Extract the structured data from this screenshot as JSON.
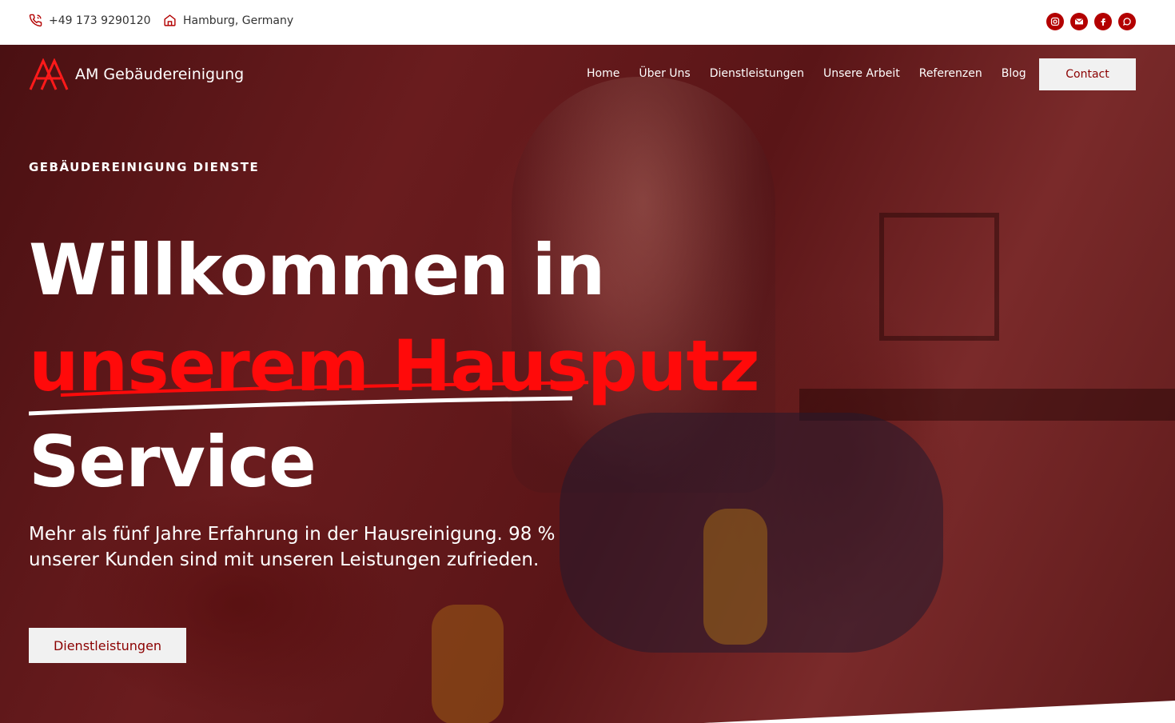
{
  "topbar": {
    "phone": "+49 173 9290120",
    "location": "Hamburg, Germany",
    "socials": [
      "instagram-icon",
      "email-icon",
      "facebook-icon",
      "whatsapp-icon"
    ]
  },
  "brand": {
    "name": "AM Gebäudereinigung",
    "accent": "#ff0a0a",
    "dark_red": "#8b0000"
  },
  "nav": {
    "items": [
      "Home",
      "Über Uns",
      "Dienstleistungen",
      "Unsere Arbeit",
      "Referenzen",
      "Blog"
    ],
    "contact_label": "Contact"
  },
  "hero": {
    "eyebrow": "GEBÄUDEREINIGUNG DIENSTE",
    "headline_line1": "Willkommen in",
    "headline_line2": "unserem Hausputz",
    "headline_line3": "Service",
    "subtext": "Mehr als fünf Jahre Erfahrung in der Hausreinigung. 98 % unserer Kunden sind mit unseren Leistungen zufrieden.",
    "cta_label": "Dienstleistungen"
  }
}
